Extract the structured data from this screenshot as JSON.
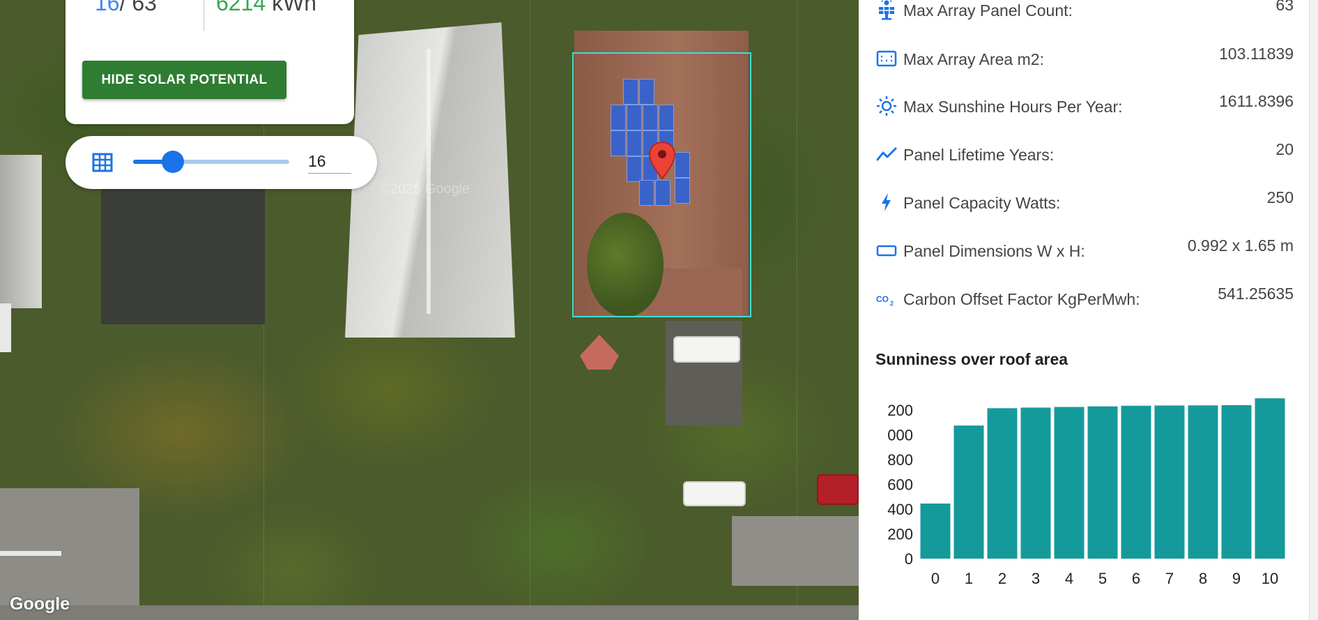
{
  "map": {
    "logo_text": "Google",
    "watermark": "©2025 Google"
  },
  "summary": {
    "panels_current": "16",
    "panels_sep": "/ 63",
    "energy_value": "6214",
    "energy_unit": "kWh",
    "hide_button_label": "HIDE SOLAR POTENTIAL"
  },
  "slider": {
    "icon": "grid-icon",
    "value": "16",
    "min": 0,
    "max": 63,
    "level": 16
  },
  "stats": [
    {
      "icon": "solar-panel-icon",
      "label": "Max Array Panel Count:",
      "value": "63"
    },
    {
      "icon": "area-icon",
      "label": "Max Array Area m2:",
      "value": "103.11839"
    },
    {
      "icon": "sun-icon",
      "label": "Max Sunshine Hours Per Year:",
      "value": "1611.8396"
    },
    {
      "icon": "trend-line-icon",
      "label": "Panel Lifetime Years:",
      "value": "20"
    },
    {
      "icon": "bolt-icon",
      "label": "Panel Capacity Watts:",
      "value": "250"
    },
    {
      "icon": "rectangle-icon",
      "label": "Panel Dimensions W x H:",
      "value": "0.992 x 1.65 m"
    },
    {
      "icon": "co2-icon",
      "label": "Carbon Offset Factor KgPerMwh:",
      "value": "541.25635"
    }
  ],
  "colors": {
    "accent_blue": "#1a73e8",
    "panel_count_blue": "#4285f4",
    "energy_green": "#34a853",
    "button_green": "#2e7d32",
    "bar_teal": "#159a9c",
    "bbox_cyan": "#3fe0d4",
    "marker_red": "#ea4335"
  },
  "chart_data": {
    "type": "bar",
    "title": "Sunniness over roof area",
    "categories": [
      "0",
      "1",
      "2",
      "3",
      "4",
      "5",
      "6",
      "7",
      "8",
      "9",
      "10"
    ],
    "values": [
      445,
      1075,
      1215,
      1220,
      1225,
      1230,
      1235,
      1237,
      1238,
      1240,
      1295
    ],
    "ytick_labels": [
      "0",
      "200",
      "400",
      "600",
      "800",
      "000",
      "200"
    ],
    "ylim": [
      0,
      1200
    ],
    "xlabel": "",
    "ylabel": "",
    "grid": false,
    "legend": "none"
  }
}
